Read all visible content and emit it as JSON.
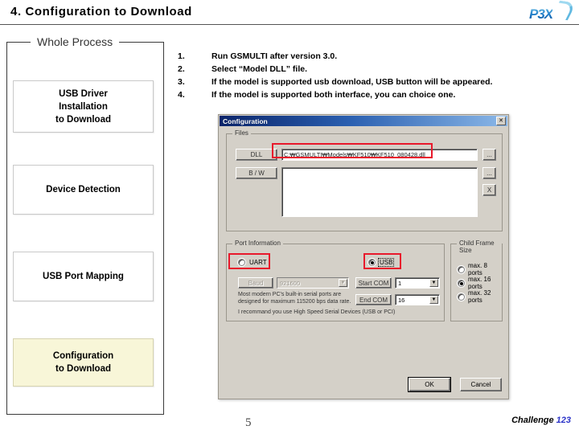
{
  "slide": {
    "title": "4. Configuration to Download",
    "page_number": "5",
    "logo_text": "P3X"
  },
  "footer": {
    "brand": "Challenge",
    "brand_number": "123"
  },
  "whole_process": {
    "legend": "Whole Process",
    "steps": [
      {
        "label": "USB Driver\nInstallation\nto Download",
        "active": false
      },
      {
        "label": "Device Detection",
        "active": false
      },
      {
        "label": "USB Port Mapping",
        "active": false
      },
      {
        "label": "Configuration\nto Download",
        "active": true
      }
    ],
    "highlight_color": "#f8f6d8"
  },
  "instructions": [
    {
      "num": "1.",
      "text": "Run GSMULTI after version 3.0."
    },
    {
      "num": "2.",
      "text": "Select “Model DLL” file."
    },
    {
      "num": "3.",
      "text": "If the model is supported usb download, USB button will be appeared."
    },
    {
      "num": "4.",
      "text": "If the model is supported both interface, you can choice one."
    }
  ],
  "dialog": {
    "title": "Configuration",
    "close_label": "✕",
    "files": {
      "legend": "Files",
      "dll_label": "DLL",
      "dll_value": "C:₩GSMULTI₩Models₩KF510₩KF510_080428.dll",
      "dll_browse_label": "...",
      "bw_label": "B / W",
      "bw_value": "",
      "bw_browse_label": "...",
      "bw_clear_label": "X"
    },
    "port_information": {
      "legend": "Port Information",
      "uart_label": "UART",
      "uart_selected": false,
      "usb_label": "USB",
      "usb_selected": true,
      "baud_label": "Baud",
      "baud_value": "921600",
      "baud_enabled": false,
      "start_com_label": "Start COM",
      "start_com_value": "1",
      "end_com_label": "End COM",
      "end_com_value": "16",
      "hint_line1": "Most modern PC's built-in serial ports are",
      "hint_line2": "designed for maximum 115200 bps data rate.",
      "hint_line3": "I recommand you use High Speed Serial Devices (USB or PCI)",
      "dropdown_arrow": "▼"
    },
    "child_frame_size": {
      "legend": "Child Frame Size",
      "options": [
        {
          "label": "max. 8 ports",
          "selected": false
        },
        {
          "label": "max. 16 ports",
          "selected": true
        },
        {
          "label": "max. 32 ports",
          "selected": false
        }
      ]
    },
    "ok_label": "OK",
    "cancel_label": "Cancel",
    "annotation_color": "#e8192c"
  }
}
